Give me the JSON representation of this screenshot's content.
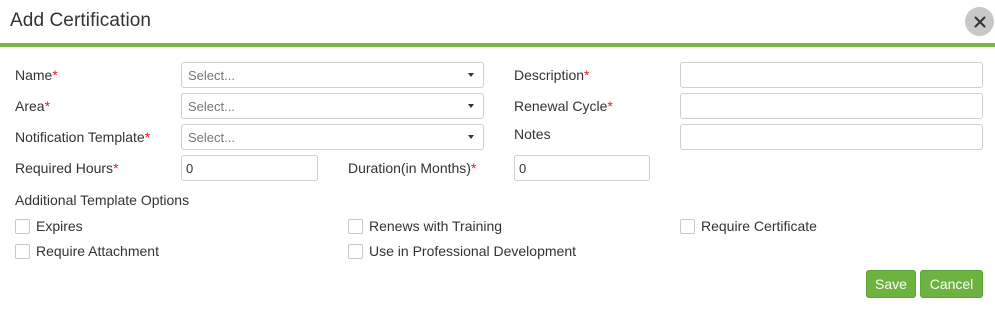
{
  "dialog": {
    "title": "Add Certification",
    "close_icon": "close-icon"
  },
  "colors": {
    "accent": "#7ab648",
    "button": "#6cb33f",
    "required": "#e02020",
    "close_bg": "#c8c8c8"
  },
  "form": {
    "name": {
      "label": "Name",
      "required_mark": "*",
      "value": "Select..."
    },
    "area": {
      "label": "Area",
      "required_mark": "*",
      "value": "Select..."
    },
    "notification_template": {
      "label": "Notification Template",
      "required_mark": "*",
      "value": "Select..."
    },
    "required_hours": {
      "label": "Required Hours",
      "required_mark": "*",
      "value": "0"
    },
    "description": {
      "label": "Description",
      "required_mark": "*",
      "value": ""
    },
    "renewal_cycle": {
      "label": "Renewal Cycle",
      "required_mark": "*",
      "value": ""
    },
    "notes": {
      "label": "Notes",
      "value": ""
    },
    "duration": {
      "label": "Duration(in Months)",
      "required_mark": "*",
      "value": "0"
    }
  },
  "options": {
    "heading": "Additional Template Options",
    "items": [
      {
        "label": "Expires",
        "checked": false
      },
      {
        "label": "Renews with Training",
        "checked": false
      },
      {
        "label": "Require Certificate",
        "checked": false
      },
      {
        "label": "Require Attachment",
        "checked": false
      },
      {
        "label": "Use in Professional Development",
        "checked": false
      }
    ]
  },
  "actions": {
    "save_label": "Save",
    "cancel_label": "Cancel"
  }
}
